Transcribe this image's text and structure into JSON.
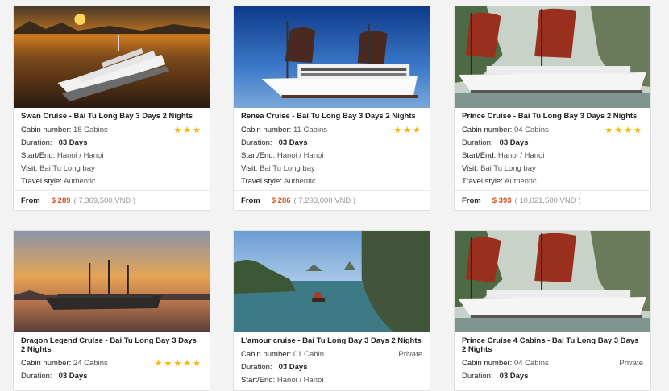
{
  "rating_color": "#f5b400",
  "price_color": "#d9531e",
  "cards": [
    {
      "title": "Swan Cruise - Bai Tu Long Bay 3 Days 2 Nights",
      "cabin_label": "Cabin number:",
      "cabin": "18 Cabins",
      "stars": "★★★",
      "duration_label": "Duration:",
      "duration": "03 Days",
      "startend_label": "Start/End:",
      "startend": "Hanoi / Hanoi",
      "visit_label": "Visit:",
      "visit": "Bai Tu Long bay",
      "style_label": "Travel style:",
      "style": "Authentic",
      "from": "From",
      "usd": "$ 289",
      "vnd": "( 7,369,500 VND )",
      "image": "sunset-cruise-ship"
    },
    {
      "title": "Renea Cruise - Bai Tu Long Bay 3 Days 2 Nights",
      "cabin_label": "Cabin number:",
      "cabin": "11 Cabins",
      "stars": "★★★",
      "duration_label": "Duration:",
      "duration": "03 Days",
      "startend_label": "Start/End:",
      "startend": "Hanoi / Hanoi",
      "visit_label": "Visit:",
      "visit": "Bai Tu Long bay",
      "style_label": "Travel style:",
      "style": "Authentic",
      "from": "From",
      "usd": "$ 286",
      "vnd": "( 7,293,000 VND )",
      "image": "junk-boat-blue-sky"
    },
    {
      "title": "Prince Cruise - Bai Tu Long Bay 3 Days 2 Nights",
      "cabin_label": "Cabin number:",
      "cabin": "04 Cabins",
      "stars": "★★★★",
      "duration_label": "Duration:",
      "duration": "03 Days",
      "startend_label": "Start/End:",
      "startend": "Hanoi / Hanoi",
      "visit_label": "Visit:",
      "visit": "Bai Tu Long bay",
      "style_label": "Travel style:",
      "style": "Authentic",
      "from": "From",
      "usd": "$ 393",
      "vnd": "( 10,021,500 VND )",
      "image": "red-sail-junk"
    },
    {
      "title": "Dragon Legend Cruise - Bai Tu Long Bay 3 Days 2 Nights",
      "cabin_label": "Cabin number:",
      "cabin": "24 Cabins",
      "stars": "★★★★★",
      "duration_label": "Duration:",
      "duration": "03 Days",
      "image": "dragon-junk-sunset"
    },
    {
      "title": "L'amour cruise - Bai Tu Long Bay 3 Days 2 Nights",
      "cabin_label": "Cabin number:",
      "cabin": "01 Cabin",
      "private": "Private",
      "duration_label": "Duration:",
      "duration": "03 Days",
      "startend_label": "Start/End:",
      "startend": "Hanoi / Hanoi",
      "image": "limestone-bay"
    },
    {
      "title": "Prince Cruise 4 Cabins - Bai Tu Long Bay 3 Days 2 Nights",
      "cabin_label": "Cabin number:",
      "cabin": "04 Cabins",
      "private": "Private",
      "duration_label": "Duration:",
      "duration": "03 Days",
      "image": "red-sail-junk"
    }
  ]
}
